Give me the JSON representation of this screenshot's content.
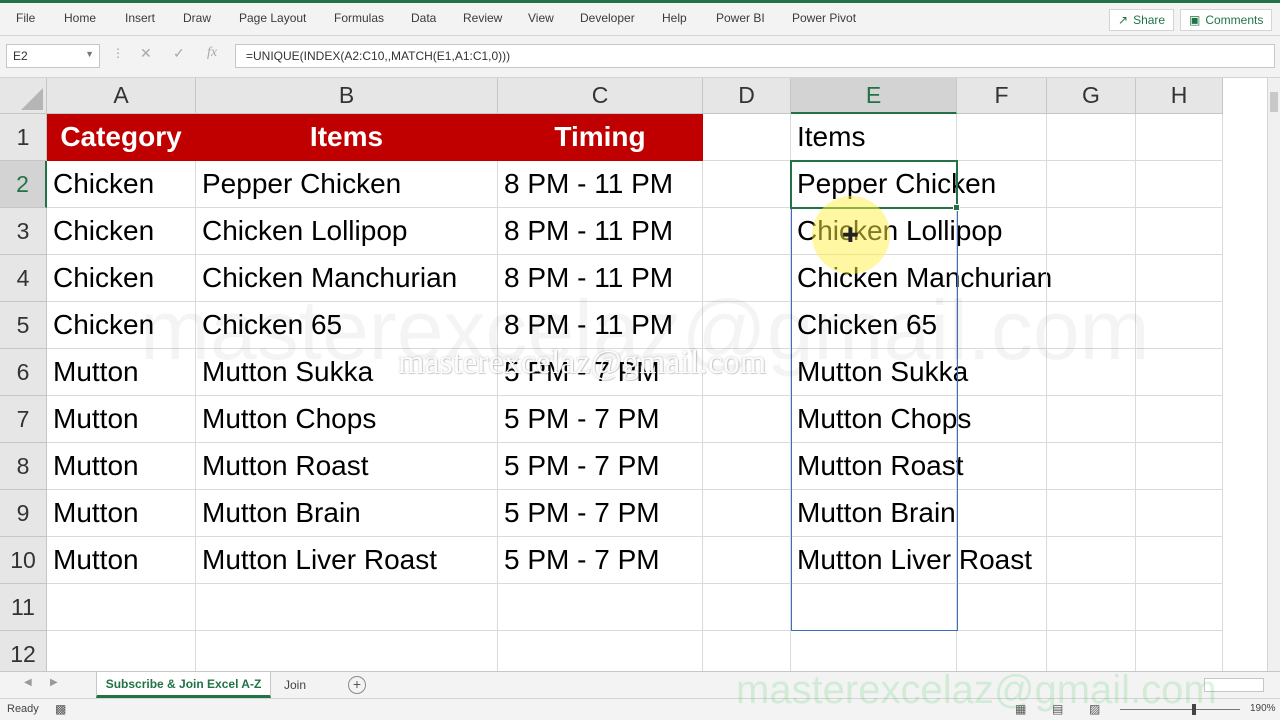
{
  "ribbon": {
    "tabs": [
      "File",
      "Home",
      "Insert",
      "Draw",
      "Page Layout",
      "Formulas",
      "Data",
      "Review",
      "View",
      "Developer",
      "Help",
      "Power BI",
      "Power Pivot"
    ],
    "share_label": "Share",
    "comments_label": "Comments"
  },
  "formula_bar": {
    "name_box": "E2",
    "fx": "fx",
    "formula": "=UNIQUE(INDEX(A2:C10,,MATCH(E1,A1:C1,0)))"
  },
  "grid": {
    "columns": [
      "A",
      "B",
      "C",
      "D",
      "E",
      "F",
      "G",
      "H"
    ],
    "selected_column": "E",
    "rows": [
      "1",
      "2",
      "3",
      "4",
      "5",
      "6",
      "7",
      "8",
      "9",
      "10",
      "11",
      "12"
    ],
    "selected_row": "2",
    "table_headers": [
      "Category",
      "Items",
      "Timing"
    ],
    "table_rows": [
      [
        "Chicken",
        "Pepper Chicken",
        "8 PM - 11 PM"
      ],
      [
        "Chicken",
        "Chicken Lollipop",
        "8 PM - 11 PM"
      ],
      [
        "Chicken",
        "Chicken Manchurian",
        "8 PM - 11 PM"
      ],
      [
        "Chicken",
        "Chicken 65",
        "8 PM - 11 PM"
      ],
      [
        "Mutton",
        "Mutton Sukka",
        "5 PM - 7 PM"
      ],
      [
        "Mutton",
        "Mutton Chops",
        "5 PM - 7 PM"
      ],
      [
        "Mutton",
        "Mutton Roast",
        "5 PM - 7 PM"
      ],
      [
        "Mutton",
        "Mutton Brain",
        "5 PM - 7 PM"
      ],
      [
        "Mutton",
        "Mutton Liver Roast",
        "5 PM - 7 PM"
      ]
    ],
    "lookup_header": "Items",
    "result_values": [
      "Pepper Chicken",
      "Chicken Lollipop",
      "Chicken Manchurian",
      "Chicken 65",
      "Mutton Sukka",
      "Mutton Chops",
      "Mutton Roast",
      "Mutton Brain",
      "Mutton Liver Roast"
    ],
    "header_fill_color": "#C00000"
  },
  "sheets": {
    "tabs": [
      "Subscribe & Join Excel A-Z",
      "Join"
    ],
    "active": "Subscribe & Join Excel A-Z",
    "add_label": "+"
  },
  "status": {
    "ready": "Ready",
    "zoom": "190%"
  },
  "watermarks": {
    "main": "masterexcelaz@gmail.com",
    "small": "masterexcelaz@gmail.com",
    "bottom": "masterexcelaz@gmail.com"
  },
  "theme": {
    "accent": "#217346",
    "spill_border": "#3A6FC4"
  }
}
